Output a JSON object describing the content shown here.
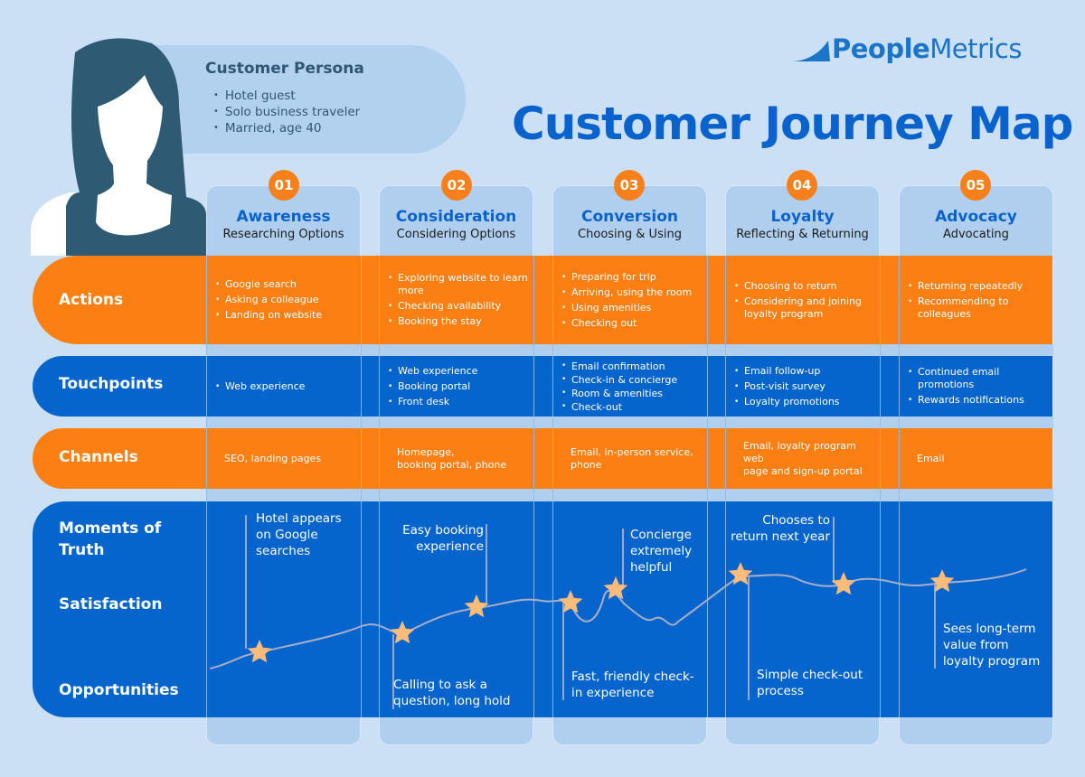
{
  "brand": {
    "logo_bold": "People",
    "logo_light": "Metrics",
    "accent_blue": "#0565cc",
    "accent_orange": "#fb7f13",
    "star_color": "#ffbb7a"
  },
  "title": "Customer Journey Map",
  "persona": {
    "title": "Customer Persona",
    "traits": [
      "Hotel guest",
      "Solo business traveler",
      "Married, age 40"
    ]
  },
  "stages": [
    {
      "number": "01",
      "name": "Awareness",
      "subtitle": "Researching Options"
    },
    {
      "number": "02",
      "name": "Consideration",
      "subtitle": "Considering Options"
    },
    {
      "number": "03",
      "name": "Conversion",
      "subtitle": "Choosing & Using"
    },
    {
      "number": "04",
      "name": "Loyalty",
      "subtitle": "Reflecting & Returning"
    },
    {
      "number": "05",
      "name": "Advocacy",
      "subtitle": "Advocating"
    }
  ],
  "rows": {
    "actions": {
      "label": "Actions",
      "cells": [
        [
          "Google search",
          "Asking a colleague",
          "Landing on website"
        ],
        [
          "Exploring website to learn more",
          "Checking availability",
          "Booking the stay"
        ],
        [
          "Preparing for trip",
          "Arriving, using the room",
          "Using amenities",
          "Checking out"
        ],
        [
          "Choosing to return",
          "Considering and joining loyalty program"
        ],
        [
          "Returning repeatedly",
          "Recommending to colleagues"
        ]
      ]
    },
    "touchpoints": {
      "label": "Touchpoints",
      "cells": [
        [
          "Web experience"
        ],
        [
          "Web experience",
          "Booking portal",
          "Front desk"
        ],
        [
          "Email confirmation",
          "Check-in & concierge",
          "Room & amenities",
          "Check-out"
        ],
        [
          "Email follow-up",
          "Post-visit survey",
          "Loyalty promotions"
        ],
        [
          "Continued email promotions",
          "Rewards notifications"
        ]
      ]
    },
    "channels": {
      "label": "Channels",
      "cells": [
        "SEO, landing pages",
        "Homepage,\nbooking portal, phone",
        "Email, in-person service,\nphone",
        "Email, loyalty program web\npage and sign-up portal",
        "Email"
      ]
    },
    "moments": {
      "label_moments": "Moments of Truth",
      "label_satisfaction": "Satisfaction",
      "label_opportunities": "Opportunities"
    }
  },
  "moments_of_truth": [
    {
      "text": "Hotel appears on Google searches",
      "type": "moment",
      "stage": 1
    },
    {
      "text": "Easy booking experience",
      "type": "moment",
      "stage": 2
    },
    {
      "text": "Concierge extremely helpful",
      "type": "moment",
      "stage": 3
    },
    {
      "text": "Chooses to return next year",
      "type": "moment",
      "stage": 4
    }
  ],
  "opportunities": [
    {
      "text": "Calling to ask a question, long hold",
      "stage": 2
    },
    {
      "text": "Fast, friendly check-in experience",
      "stage": 3
    },
    {
      "text": "Simple check-out process",
      "stage": 4
    },
    {
      "text": "Sees long-term value from loyalty program",
      "stage": 5
    }
  ],
  "satisfaction_stars": 8
}
